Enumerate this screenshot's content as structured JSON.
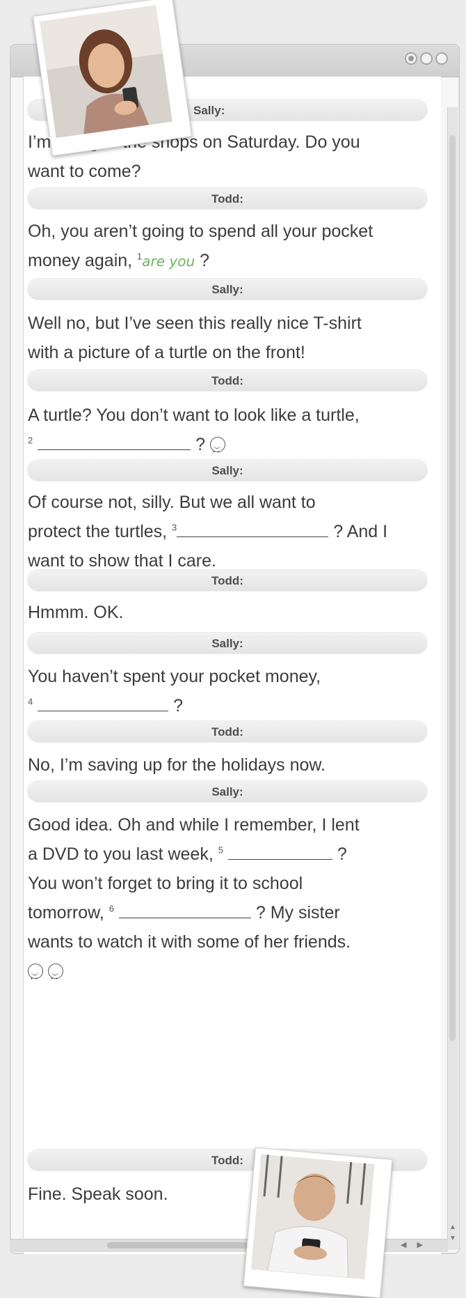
{
  "window": {
    "buttons": [
      "zoom-button",
      "minimize-button",
      "close-button"
    ]
  },
  "conversation": [
    {
      "speaker": "Sally:",
      "parts": [
        "I’m going to the shops on Saturday. Do you",
        "want to come?"
      ]
    },
    {
      "speaker": "Todd:",
      "parts": [
        "Oh, you aren’t going to spend all your pocket",
        "money again, ",
        "1",
        "are you",
        " ?"
      ]
    },
    {
      "speaker": "Sally:",
      "parts": [
        "Well no, but I’ve seen this really nice T-shirt",
        "with a picture of a turtle on the front!"
      ]
    },
    {
      "speaker": "Todd:",
      "parts": [
        "A turtle? You don’t want to look like a turtle,",
        "2",
        "?"
      ]
    },
    {
      "speaker": "Sally:",
      "parts": [
        "Of course not, silly. But we all want to",
        "protect the turtles, ",
        "3",
        "? And I",
        "want to show that I care."
      ]
    },
    {
      "speaker": "Todd:",
      "parts": [
        "Hmmm. OK."
      ]
    },
    {
      "speaker": "Sally:",
      "parts": [
        "You haven’t spent your pocket money,",
        "4",
        "?"
      ]
    },
    {
      "speaker": "Todd:",
      "parts": [
        "No, I’m saving up for the holidays now."
      ]
    },
    {
      "speaker": "Sally:",
      "parts": [
        "Good idea. Oh and while I remember, I lent",
        "a DVD to you last week, ",
        "5",
        "?",
        "You won’t forget to bring it to school",
        "tomorrow, ",
        "6",
        "? My sister",
        "wants to watch it with some of her friends."
      ]
    },
    {
      "speaker": "Todd:",
      "parts": [
        "Fine. Speak soon."
      ]
    }
  ],
  "photos": [
    {
      "name": "sally-photo",
      "icon": "girl-with-phone-photo"
    },
    {
      "name": "todd-photo",
      "icon": "boy-with-phone-photo"
    }
  ],
  "scrollbars": {
    "horizontal_arrows": "◀ ▶",
    "vertical_arrows": "▲▼"
  }
}
